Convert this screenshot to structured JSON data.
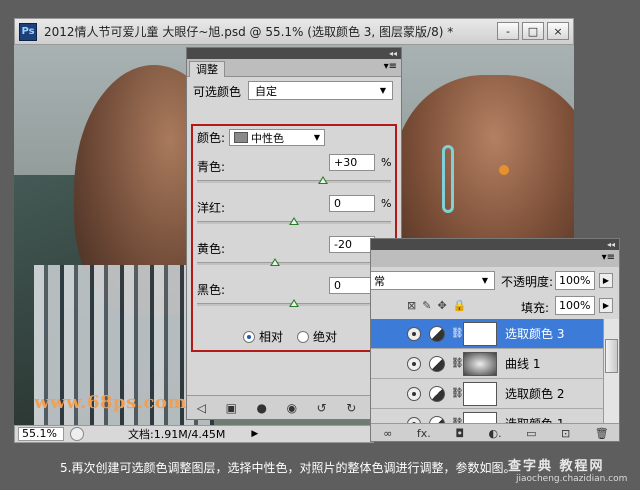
{
  "window": {
    "app_icon": "Ps",
    "title": "2012情人节可爱儿童  大眼仔~旭.psd @ 55.1% (选取颜色 3, 图层蒙版/8) *",
    "buttons": [
      "-",
      "□",
      "×"
    ]
  },
  "canvas": {
    "watermark": "www.68ps.com"
  },
  "status_bar": {
    "zoom": "55.1%",
    "doc_info": "文档:1.91M/4.45M",
    "arrow": "▶"
  },
  "adjustments_panel": {
    "collapse": "◂◂",
    "tab": "调整",
    "preset_label": "可选颜色",
    "preset_value": "自定",
    "color_label": "颜色:",
    "color_value": "中性色",
    "sliders": [
      {
        "label": "青色:",
        "value": "+30",
        "unit": "%",
        "fraction": 0.65
      },
      {
        "label": "洋红:",
        "value": "0",
        "unit": "%",
        "fraction": 0.5
      },
      {
        "label": "黄色:",
        "value": "-20",
        "unit": "%",
        "fraction": 0.4
      },
      {
        "label": "黑色:",
        "value": "0",
        "unit": "%",
        "fraction": 0.5
      }
    ],
    "method_relative": "相对",
    "method_absolute": "绝对",
    "bottom_icons": [
      "◁",
      "▣",
      "●",
      "◉",
      "↺",
      "↻",
      "🗑"
    ]
  },
  "layers_panel": {
    "collapse": "◂◂",
    "blend_mode": "常",
    "opacity_label": "不透明度:",
    "opacity_value": "100%",
    "fill_label": "填充:",
    "fill_value": "100%",
    "layers": [
      {
        "name": "选取颜色 3",
        "selected": true
      },
      {
        "name": "曲线 1",
        "selected": false
      },
      {
        "name": "选取颜色 2",
        "selected": false
      },
      {
        "name": "选取颜色 1",
        "selected": false
      }
    ],
    "bottom_icons": [
      "∞",
      "fx.",
      "◘",
      "◐.",
      "▭",
      "⊡",
      "🗑"
    ]
  },
  "caption": "5.再次创建可选颜色调整图层，选择中性色，对照片的整体色调进行调整，参数如图。",
  "brand": "查字典 教程网",
  "brand_url": "jiaocheng.chazidian.com"
}
